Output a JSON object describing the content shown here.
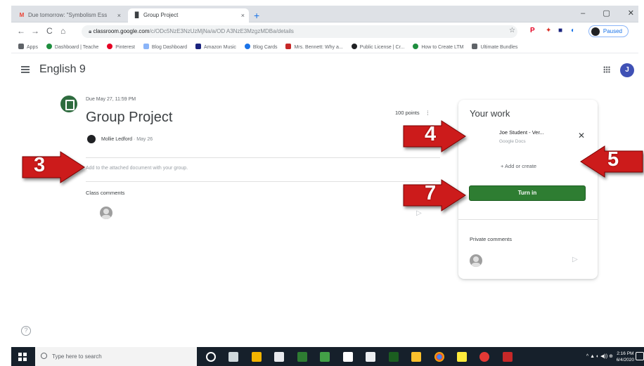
{
  "browser": {
    "tabs": [
      {
        "label": "Due tomorrow: \"Symbolism Ess",
        "favicon": "M",
        "favicon_color": "#ea4335",
        "active": false
      },
      {
        "label": "Group Project",
        "favicon": "▉",
        "favicon_color": "#202124",
        "active": true
      }
    ],
    "tab_close": "×",
    "new_tab": "+",
    "window_controls": {
      "minimize": "–",
      "maximize": "▢",
      "close": "✕"
    },
    "nav": {
      "back": "←",
      "forward": "→",
      "reload": "C",
      "home": "⌂"
    },
    "address_host": "classroom.google.com",
    "address_path": "/c/ODc5NzE3NzUzMjNa/a/OD A3NzE3MzgzMDBa/details",
    "star": "☆",
    "profile_label": "Paused",
    "bookmarks": [
      {
        "label": "Apps",
        "color": "#5f6368"
      },
      {
        "label": "Dashboard | Teache",
        "color": "#1e8e3e"
      },
      {
        "label": "Pinterest",
        "color": "#e60023"
      },
      {
        "label": "Blog Dashboard",
        "color": "#8ab4f8"
      },
      {
        "label": "Amazon Music",
        "color": "#1a237e"
      },
      {
        "label": "Blog Cards",
        "color": "#1a73e8"
      },
      {
        "label": "Mrs. Bennett: Why a...",
        "color": "#c62828"
      },
      {
        "label": "Public License | Cr...",
        "color": "#202124"
      },
      {
        "label": "How to Create LTM",
        "color": "#1e8e3e"
      },
      {
        "label": "Ultimate Bundles",
        "color": "#5f6368"
      }
    ]
  },
  "classroom": {
    "class_name": "English 9",
    "profile_initial": "J",
    "assignment": {
      "due": "Due May 27, 11:59 PM",
      "title": "Group Project",
      "points": "100 points",
      "points_more": "⋮",
      "author": "Mollie Ledford",
      "date": "· May 26",
      "description": "Add to the attached document with your group.",
      "class_comments_label": "Class comments",
      "send": "▷"
    },
    "your_work": {
      "title": "Your work",
      "attachment_title": "Joe Student - Ver...",
      "attachment_sub": "Google Docs",
      "remove": "✕",
      "add_or_create": "+ Add or create",
      "turn_in": "Turn in",
      "private_comments_label": "Private comments",
      "send": "▷"
    },
    "help": "?"
  },
  "callouts": [
    {
      "number": "3",
      "direction": "right"
    },
    {
      "number": "4",
      "direction": "right"
    },
    {
      "number": "5",
      "direction": "left"
    },
    {
      "number": "7",
      "direction": "right"
    }
  ],
  "callout_color": "#cc1b1b",
  "taskbar": {
    "search_placeholder": "Type here to search",
    "time": "2:16 PM",
    "date": "6/4/2020",
    "tray": "^ ▲ ◐ ◀)) ⊕"
  }
}
